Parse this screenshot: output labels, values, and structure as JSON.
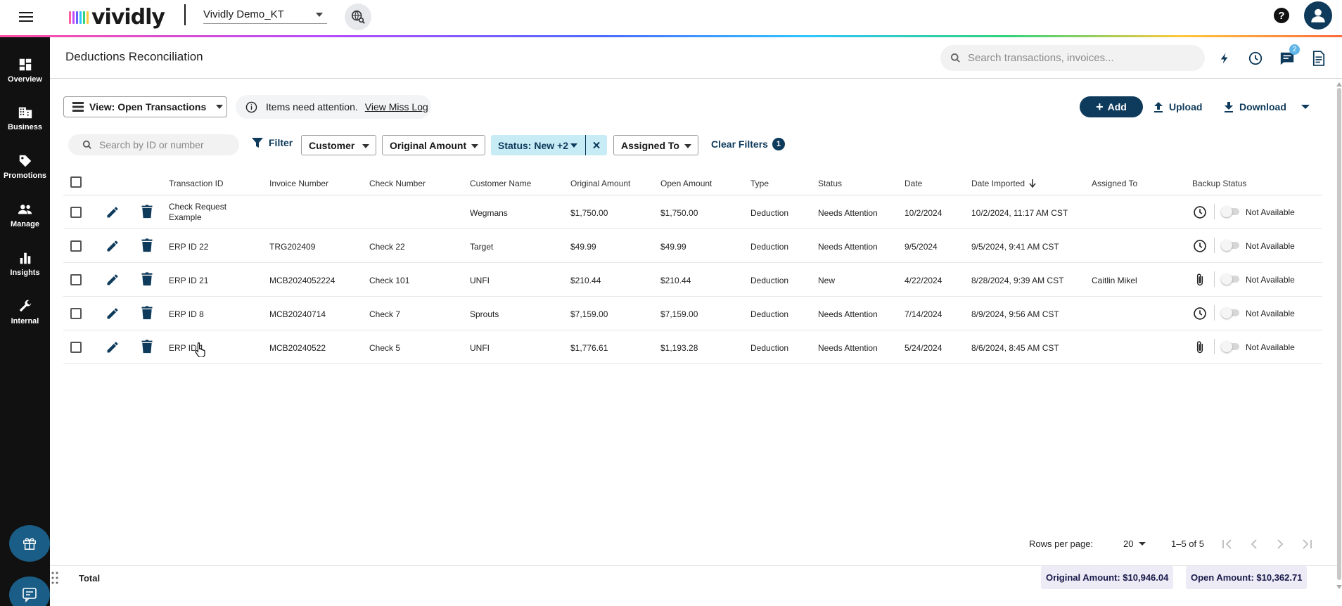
{
  "app": {
    "brand": "vividly",
    "organization": "Vividly Demo_KT",
    "colors": {
      "navy": "#0e3a5b",
      "chip": "#c8ecf6",
      "sidebar": "#111111"
    }
  },
  "sidebar": {
    "items": [
      {
        "label": "Overview",
        "icon": "dashboard-icon"
      },
      {
        "label": "Business",
        "icon": "building-icon"
      },
      {
        "label": "Promotions",
        "icon": "tag-icon"
      },
      {
        "label": "Manage",
        "icon": "people-icon"
      },
      {
        "label": "Insights",
        "icon": "bar-chart-icon"
      },
      {
        "label": "Internal",
        "icon": "wrench-icon"
      }
    ]
  },
  "header": {
    "title": "Deductions Reconciliation",
    "search_placeholder": "Search transactions, invoices...",
    "messages_badge": "2"
  },
  "toolbar": {
    "view_label": "View: Open Transactions",
    "attention_text": "Items need attention.",
    "miss_log_link": "View Miss Log",
    "add_label": "Add",
    "upload_label": "Upload",
    "download_label": "Download"
  },
  "filters": {
    "search_placeholder": "Search by ID or number",
    "filter_label": "Filter",
    "customer": "Customer",
    "original_amount": "Original Amount",
    "status": "Status: New +2",
    "assigned_to": "Assigned To",
    "clear_label": "Clear Filters",
    "clear_count": "1"
  },
  "table": {
    "columns": {
      "transaction_id": "Transaction ID",
      "invoice_number": "Invoice Number",
      "check_number": "Check Number",
      "customer_name": "Customer Name",
      "original_amount": "Original Amount",
      "open_amount": "Open Amount",
      "type": "Type",
      "status": "Status",
      "date": "Date",
      "date_imported": "Date Imported",
      "assigned_to": "Assigned To",
      "backup_status": "Backup Status"
    },
    "rows": [
      {
        "transaction_id": "Check Request Example",
        "invoice": "",
        "check": "",
        "customer": "Wegmans",
        "original": "$1,750.00",
        "open": "$1,750.00",
        "type": "Deduction",
        "status": "Needs Attention",
        "date": "10/2/2024",
        "imported": "10/2/2024, 11:17 AM CST",
        "assigned": "",
        "backup_icon": "clock-icon",
        "backup_text": "Not Available"
      },
      {
        "transaction_id": "ERP ID 22",
        "invoice": "TRG202409",
        "check": "Check 22",
        "customer": "Target",
        "original": "$49.99",
        "open": "$49.99",
        "type": "Deduction",
        "status": "Needs Attention",
        "date": "9/5/2024",
        "imported": "9/5/2024, 9:41 AM CST",
        "assigned": "",
        "backup_icon": "clock-icon",
        "backup_text": "Not Available"
      },
      {
        "transaction_id": "ERP ID 21",
        "invoice": "MCB2024052224",
        "check": "Check 101",
        "customer": "UNFI",
        "original": "$210.44",
        "open": "$210.44",
        "type": "Deduction",
        "status": "New",
        "date": "4/22/2024",
        "imported": "8/28/2024, 9:39 AM CST",
        "assigned": "Caitlin Mikel",
        "backup_icon": "paperclip-icon",
        "backup_text": "Not Available"
      },
      {
        "transaction_id": "ERP ID 8",
        "invoice": "MCB20240714",
        "check": "Check 7",
        "customer": "Sprouts",
        "original": "$7,159.00",
        "open": "$7,159.00",
        "type": "Deduction",
        "status": "Needs Attention",
        "date": "7/14/2024",
        "imported": "8/9/2024, 9:56 AM CST",
        "assigned": "",
        "backup_icon": "clock-icon",
        "backup_text": "Not Available"
      },
      {
        "transaction_id": "ERP ID 1",
        "invoice": "MCB20240522",
        "check": "Check 5",
        "customer": "UNFI",
        "original": "$1,776.61",
        "open": "$1,193.28",
        "type": "Deduction",
        "status": "Needs Attention",
        "date": "5/24/2024",
        "imported": "8/6/2024, 8:45 AM CST",
        "assigned": "",
        "backup_icon": "paperclip-icon",
        "backup_text": "Not Available"
      }
    ]
  },
  "pagination": {
    "rows_per_page_label": "Rows per page:",
    "rows_per_page": "20",
    "range": "1–5 of 5"
  },
  "footer": {
    "total_label": "Total",
    "original_amount": "Original Amount: $10,946.04",
    "open_amount": "Open Amount: $10,362.71"
  }
}
